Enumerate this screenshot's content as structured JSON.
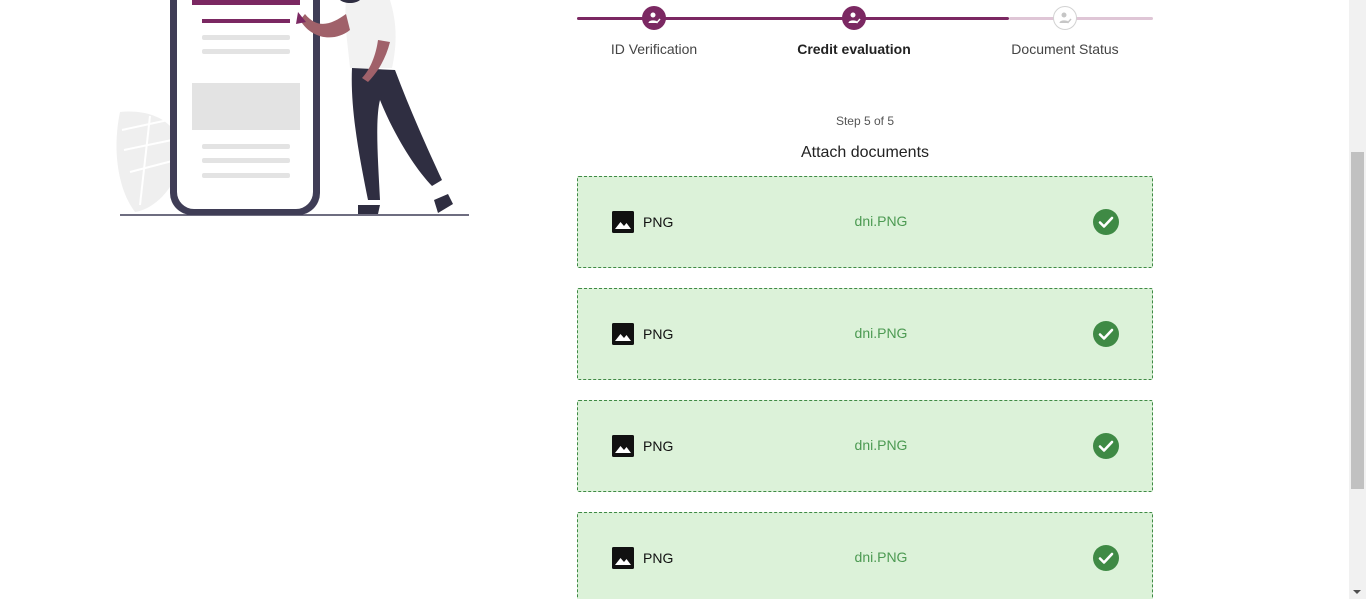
{
  "stepper": {
    "steps": [
      {
        "label": "ID Verification",
        "state": "done"
      },
      {
        "label": "Credit evaluation",
        "state": "active"
      },
      {
        "label": "Document Status",
        "state": "pending"
      }
    ]
  },
  "form": {
    "step_counter": "Step 5 of 5",
    "title": "Attach documents"
  },
  "documents": [
    {
      "type": "PNG",
      "filename": "dni.PNG",
      "status": "uploaded",
      "type_icon": "image-icon",
      "status_icon": "check-circle-icon"
    },
    {
      "type": "PNG",
      "filename": "dni.PNG",
      "status": "uploaded",
      "type_icon": "image-icon",
      "status_icon": "check-circle-icon"
    },
    {
      "type": "PNG",
      "filename": "dni.PNG",
      "status": "uploaded",
      "type_icon": "image-icon",
      "status_icon": "check-circle-icon"
    },
    {
      "type": "PNG",
      "filename": "dni.PNG",
      "status": "uploaded",
      "type_icon": "image-icon",
      "status_icon": "check-circle-icon"
    }
  ],
  "colors": {
    "brand": "#7b2862",
    "brand_light": "#dfc6d6",
    "success": "#3f8a45",
    "success_bg": "#dcf2d9"
  }
}
